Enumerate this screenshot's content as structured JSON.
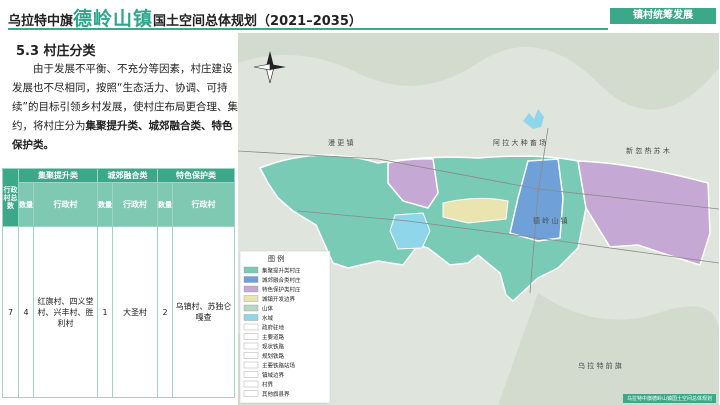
{
  "header": {
    "title_prefix": "乌拉特中旗",
    "title_town": "德岭山镇",
    "title_suffix": "国土空间总体规划（2021–2035）",
    "tag": "镇村统筹发展"
  },
  "section": {
    "title": "5.3 村庄分类",
    "para_part1": "由于发展不平衡、不充分等因素，村庄建设发展也不尽相同，按照“生态活力、协调、可持续”的目标引领乡村发展，使村庄布局更合理、集约，将村庄分为",
    "para_bold": "集聚提升类、城郊融合类、特色保护类",
    "para_end": "。"
  },
  "table": {
    "total_header": "行政村总数",
    "groups": [
      "集聚提升类",
      "城郊融合类",
      "特色保护类"
    ],
    "count_label": "数量",
    "village_label": "行政村",
    "total": "7",
    "agg_count": "4",
    "agg_villages": "红旗村、四义堂村、兴丰村、胜利村",
    "sub_count": "1",
    "sub_villages": "大圣村",
    "fea_count": "2",
    "fea_villages": "乌镇村、苏独仑嘎查"
  },
  "map": {
    "labels": [
      "漫 更 镇",
      "阿 拉 大 种 畜 场",
      "新 忽 热 苏 木",
      "德 岭 山 镇",
      "乌 拉 特 前 旗"
    ],
    "legend_title": "图 例",
    "legend": [
      {
        "label": "集聚提升类村庄",
        "color": "#79cbb5"
      },
      {
        "label": "城郊融合类村庄",
        "color": "#6fa0d8"
      },
      {
        "label": "特色保护类村庄",
        "color": "#c6a8d4"
      },
      {
        "label": "城镇开发边界",
        "color": "#e9e4b0"
      },
      {
        "label": "山体",
        "color": "#b8d7c5"
      },
      {
        "label": "水域",
        "color": "#8fd6ea"
      },
      {
        "label": "政府驻地",
        "color": "#ffffff"
      },
      {
        "label": "主要道路",
        "color": "#ffffff"
      },
      {
        "label": "现状铁路",
        "color": "#ffffff"
      },
      {
        "label": "规划铁路",
        "color": "#ffffff"
      },
      {
        "label": "主要铁路站场",
        "color": "#ffffff"
      },
      {
        "label": "镇域边界",
        "color": "#ffffff"
      },
      {
        "label": "村界",
        "color": "#ffffff"
      },
      {
        "label": "其他旗县界",
        "color": "#ffffff"
      }
    ]
  },
  "footer": "乌拉特中旗德岭山镇国土空间总体规划"
}
